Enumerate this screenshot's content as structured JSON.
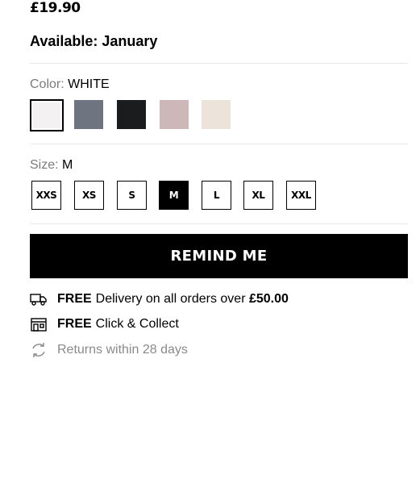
{
  "product": {
    "price": "£19.90",
    "availability": "Available: January"
  },
  "color": {
    "label": "Color:",
    "selected": "WHITE",
    "swatches": [
      {
        "name": "white",
        "hex": "#f3f1f1"
      },
      {
        "name": "gray",
        "hex": "#6e7480"
      },
      {
        "name": "black",
        "hex": "#1b1c1d"
      },
      {
        "name": "pink",
        "hex": "#cdb7b8"
      },
      {
        "name": "natural",
        "hex": "#ece3da"
      }
    ]
  },
  "size": {
    "label": "Size:",
    "selected": "M",
    "options": [
      "XXS",
      "XS",
      "S",
      "M",
      "L",
      "XL",
      "XXL"
    ]
  },
  "cta": {
    "label": "REMIND ME"
  },
  "info": {
    "delivery": {
      "bold": "FREE",
      "text": "Delivery on all orders over",
      "amount": "£50.00",
      "icon": "truck-icon"
    },
    "collect": {
      "bold": "FREE",
      "text": "Click & Collect",
      "icon": "store-icon"
    },
    "returns": {
      "text": "Returns within 28 days",
      "icon": "returns-icon"
    }
  }
}
